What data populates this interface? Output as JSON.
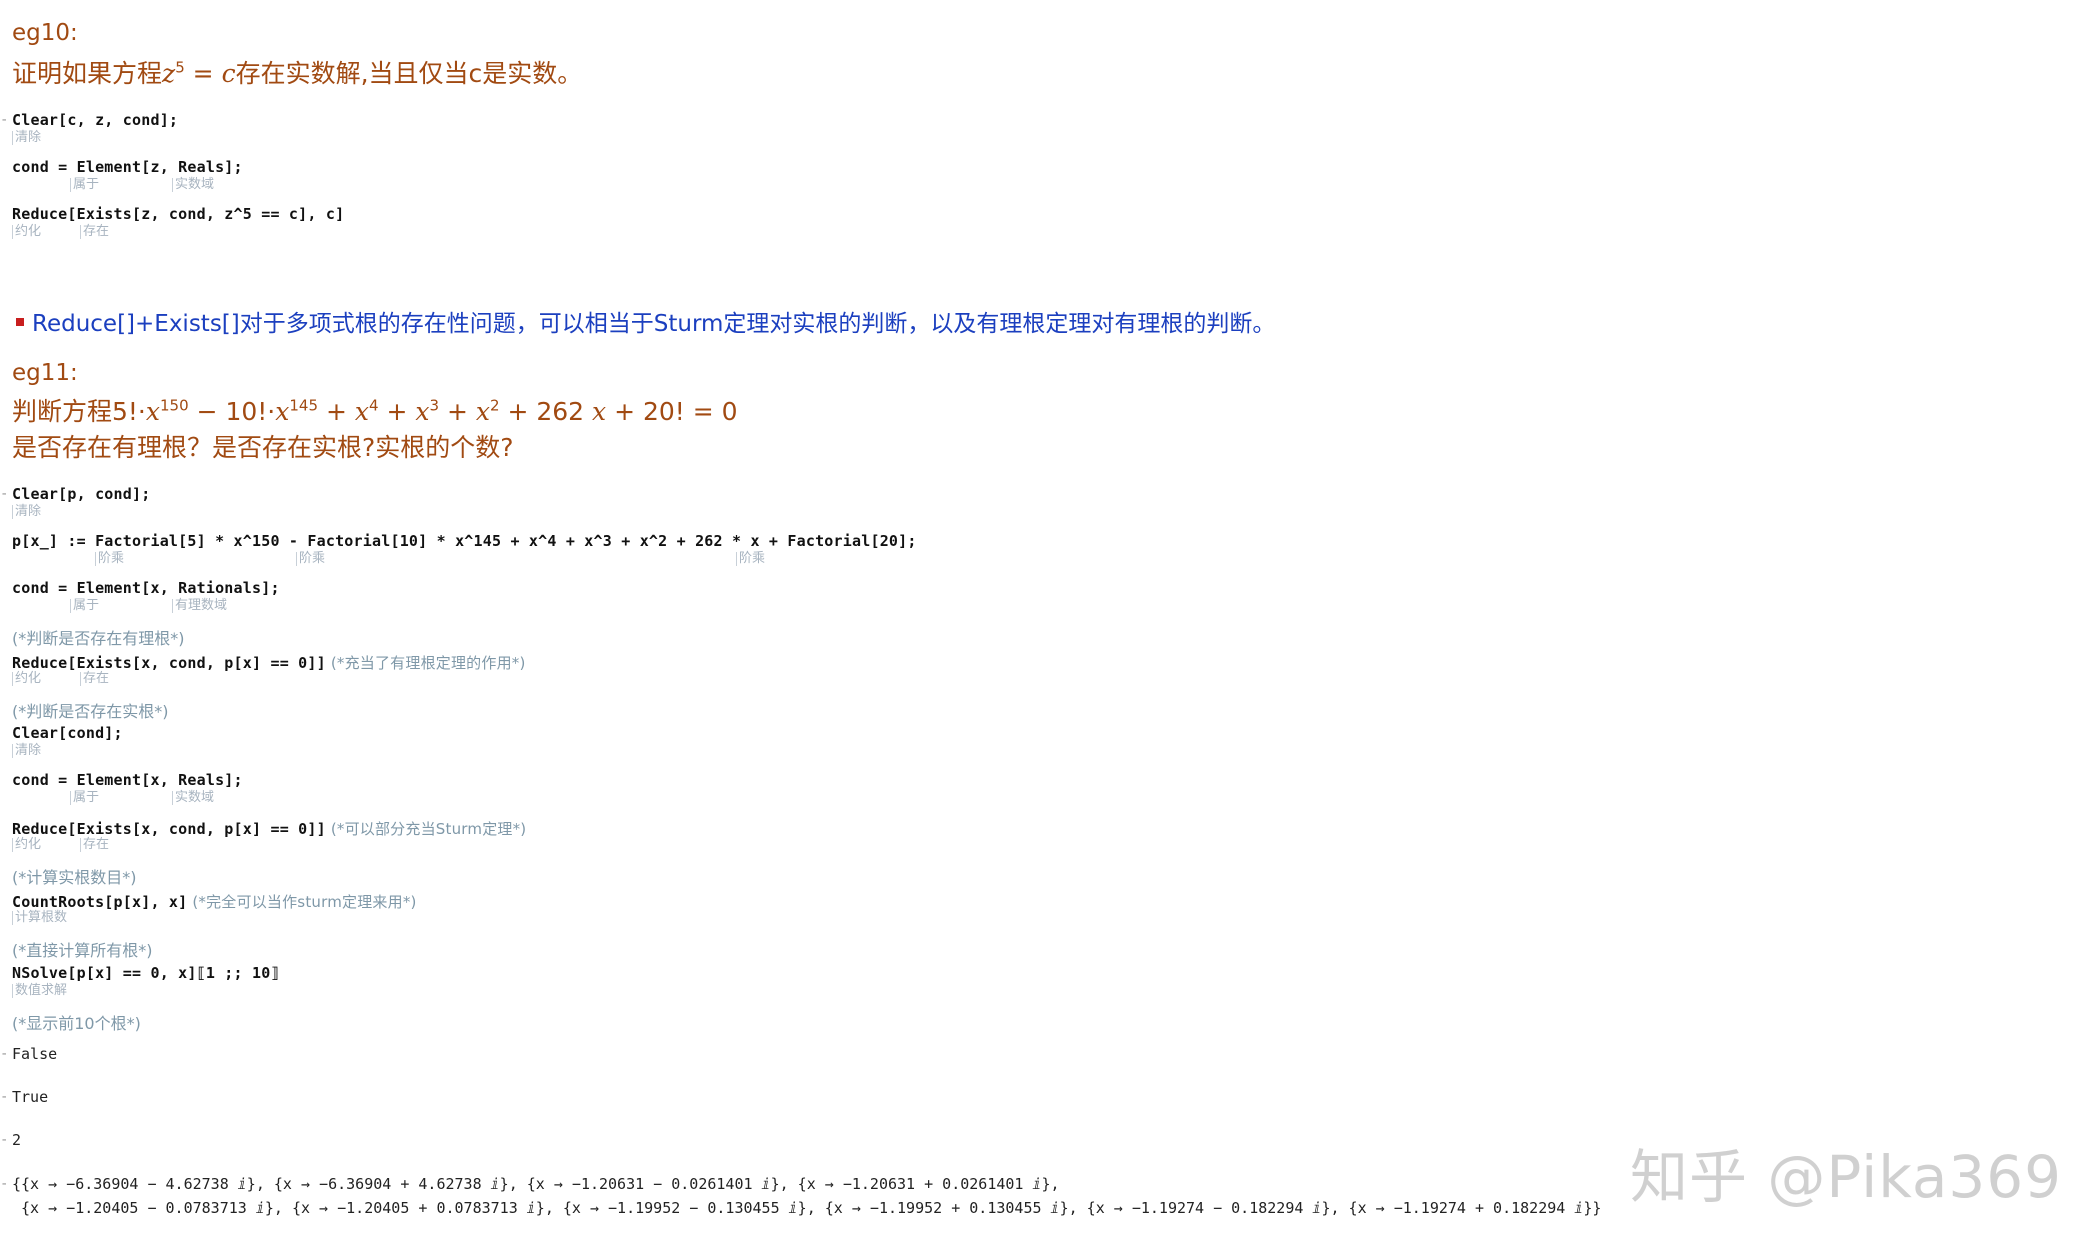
{
  "eg10": {
    "label": "eg10:",
    "statement_pre": "证明如果方程",
    "statement_var": "z",
    "statement_exp": "5",
    "statement_eq": " = ",
    "statement_c": "c",
    "statement_post": "存在实数解,当且仅当c是实数。",
    "code": {
      "line1": "Clear[c, z, cond];",
      "line2_pre": "cond = Element[z, Reals];",
      "line3": "Reduce[Exists[z, cond, z^5 == c], c]"
    },
    "hints": {
      "clear": "清除",
      "element": "属于",
      "reals": "实数域",
      "reduce": "约化",
      "exists": "存在"
    }
  },
  "note": "Reduce[]+Exists[]对于多项式根的存在性问题，可以相当于Sturm定理对实根的判断，以及有理根定理对有理根的判断。",
  "eg11": {
    "label": "eg11:",
    "line1_pre": "判断方程5!·",
    "line1_x1": "x",
    "line1_e1": "150",
    "line1_mid1": " − 10!·",
    "line1_x2": "x",
    "line1_e2": "145",
    "line1_p1": " + ",
    "line1_x3": "x",
    "line1_e3": "4",
    "line1_p2": " + ",
    "line1_x4": "x",
    "line1_e4": "3",
    "line1_p3": " + ",
    "line1_x5": "x",
    "line1_e5": "2",
    "line1_p4": " + 262 ",
    "line1_x6": "x",
    "line1_tail": " + 20! = 0",
    "line2": "是否存在有理根？是否存在实根?实根的个数?",
    "code": {
      "clear1": "Clear[p, cond];",
      "pdef": "p[x_] := Factorial[5] * x^150 - Factorial[10] * x^145 + x^4 + x^3 + x^2 + 262 * x + Factorial[20];",
      "cond_q": "cond = Element[x, Rationals];",
      "c_rational": "(*判断是否存在有理根*)",
      "reduce1": "Reduce[Exists[x, cond, p[x] == 0]]",
      "reduce1_comment": " (*充当了有理根定理的作用*)",
      "c_real": "(*判断是否存在实根*)",
      "clear2": "Clear[cond];",
      "cond_r": "cond = Element[x, Reals];",
      "reduce2": "Reduce[Exists[x, cond, p[x] == 0]]",
      "reduce2_comment": " (*可以部分充当Sturm定理*)",
      "c_count": "(*计算实根数目*)",
      "countroots": "CountRoots[p[x], x]",
      "countroots_comment": " (*完全可以当作sturm定理来用*)",
      "c_all": "(*直接计算所有根*)",
      "nsolve": "NSolve[p[x] == 0, x]⟦1 ;; 10⟧",
      "c_first10": "(*显示前10个根*)"
    },
    "hints": {
      "clear": "清除",
      "factorial": "阶乘",
      "element": "属于",
      "rationals": "有理数域",
      "reals": "实数域",
      "reduce": "约化",
      "exists": "存在",
      "countroots": "计算根数",
      "nsolve": "数值求解"
    },
    "outputs": {
      "o1": "False",
      "o2": "True",
      "o3": "2",
      "o4a": "{{x → −6.36904 − 4.62738 ⅈ}, {x → −6.36904 + 4.62738 ⅈ}, {x → −1.20631 − 0.0261401 ⅈ}, {x → −1.20631 + 0.0261401 ⅈ},",
      "o4b": " {x → −1.20405 − 0.0783713 ⅈ}, {x → −1.20405 + 0.0783713 ⅈ}, {x → −1.19952 − 0.130455 ⅈ}, {x → −1.19952 + 0.130455 ⅈ}, {x → −1.19274 − 0.182294 ⅈ}, {x → −1.19274 + 0.182294 ⅈ}}"
    }
  },
  "watermark": "知乎 @Pika369",
  "colors": {
    "heading": "#a14a12",
    "note": "#1b3fbf",
    "bullet": "#c81e1e",
    "variable": "#2f5fb3",
    "comment": "#7f98a8"
  }
}
